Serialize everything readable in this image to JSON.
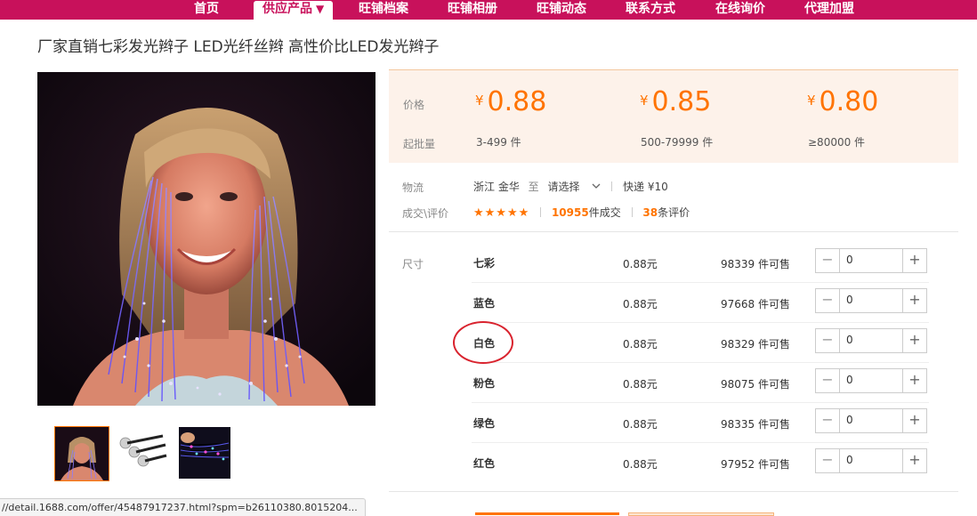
{
  "nav": {
    "items": [
      "首页",
      "供应产品",
      "旺铺档案",
      "旺铺相册",
      "旺铺动态",
      "联系方式",
      "在线询价",
      "代理加盟"
    ],
    "active_arrow": "▼"
  },
  "product": {
    "title": "厂家直销七彩发光辫子 LED光纤丝辫 高性价比LED发光辫子"
  },
  "pricing": {
    "price_label": "价格",
    "moq_label": "起批量",
    "currency": "¥",
    "tiers": [
      {
        "price": "0.88",
        "quantity": "3-499 件"
      },
      {
        "price": "0.85",
        "quantity": "500-79999 件"
      },
      {
        "price": "0.80",
        "quantity": "≥80000 件"
      }
    ]
  },
  "logistics": {
    "label": "物流",
    "origin": "浙江 金华",
    "to": "至",
    "destination": "请选择",
    "shipping": "快递 ¥10"
  },
  "reviews": {
    "label": "成交\\评价",
    "stars": "★★★★★",
    "sales_count": "10955",
    "sales_suffix": "件成交",
    "review_count": "38",
    "review_suffix": "条评价"
  },
  "sku": {
    "label": "尺寸",
    "rows": [
      {
        "name": "七彩",
        "price": "0.88元",
        "stock": "98339 件可售",
        "qty": "0"
      },
      {
        "name": "蓝色",
        "price": "0.88元",
        "stock": "97668 件可售",
        "qty": "0"
      },
      {
        "name": "白色",
        "price": "0.88元",
        "stock": "98329 件可售",
        "qty": "0"
      },
      {
        "name": "粉色",
        "price": "0.88元",
        "stock": "98075 件可售",
        "qty": "0"
      },
      {
        "name": "绿色",
        "price": "0.88元",
        "stock": "98335 件可售",
        "qty": "0"
      },
      {
        "name": "红色",
        "price": "0.88元",
        "stock": "97952 件可售",
        "qty": "0"
      }
    ],
    "minus": "−",
    "plus": "+"
  },
  "status_bar": {
    "url": "//detail.1688.com/offer/45487917237.html?spm=b26110380.8015204..."
  },
  "colors": {
    "nav_bg": "#c8115b",
    "accent": "#ff7300",
    "price_panel_bg": "#fdf2ea",
    "annotation_circle": "#d9232e"
  }
}
